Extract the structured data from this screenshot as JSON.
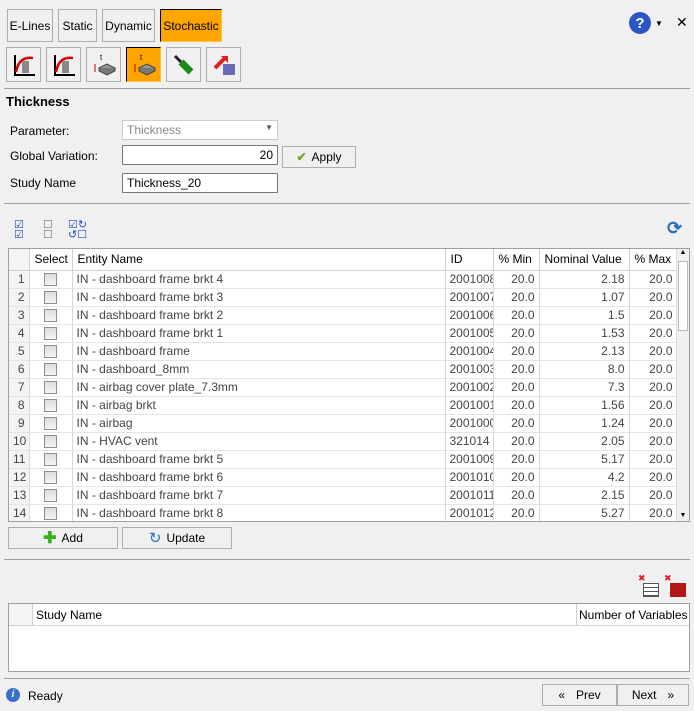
{
  "tabs": [
    {
      "label": "E-Lines",
      "active": false
    },
    {
      "label": "Static",
      "active": false
    },
    {
      "label": "Dynamic",
      "active": false
    },
    {
      "label": "Stochastic",
      "active": true
    }
  ],
  "toolbar_icons": [
    "tensile-test-icon",
    "tensile-test-curve-icon",
    "thickness-icon",
    "thickness-stochastic-icon",
    "screwdriver-icon",
    "export-mesh-icon"
  ],
  "help_icon": "help-icon",
  "accent": "#ffa500",
  "section_title": "Thickness",
  "form": {
    "parameter_label": "Parameter:",
    "parameter_value": "Thickness",
    "global_variation_label": "Global Variation:",
    "global_variation_value": "20",
    "apply_label": "Apply",
    "study_name_label": "Study Name",
    "study_name_value": "Thickness_20"
  },
  "table": {
    "columns": [
      "",
      "Select",
      "Entity Name",
      "ID",
      "% Min",
      "Nominal Value",
      "% Max"
    ],
    "rows": [
      [
        "1",
        "IN - dashboard frame brkt 4",
        "2001008",
        "20.0",
        "2.18",
        "20.0"
      ],
      [
        "2",
        "IN - dashboard frame brkt 3",
        "2001007",
        "20.0",
        "1.07",
        "20.0"
      ],
      [
        "3",
        "IN - dashboard frame brkt 2",
        "2001006",
        "20.0",
        "1.5",
        "20.0"
      ],
      [
        "4",
        "IN - dashboard frame brkt 1",
        "2001005",
        "20.0",
        "1.53",
        "20.0"
      ],
      [
        "5",
        "IN - dashboard frame",
        "2001004",
        "20.0",
        "2.13",
        "20.0"
      ],
      [
        "6",
        "IN - dashboard_8mm",
        "2001003",
        "20.0",
        "8.0",
        "20.0"
      ],
      [
        "7",
        "IN - airbag cover plate_7.3mm",
        "2001002",
        "20.0",
        "7.3",
        "20.0"
      ],
      [
        "8",
        "IN - airbag brkt",
        "2001001",
        "20.0",
        "1.56",
        "20.0"
      ],
      [
        "9",
        "IN - airbag",
        "2001000",
        "20.0",
        "1.24",
        "20.0"
      ],
      [
        "10",
        "IN - HVAC vent",
        "321014",
        "20.0",
        "2.05",
        "20.0"
      ],
      [
        "11",
        "IN - dashboard frame brkt 5",
        "2001009",
        "20.0",
        "5.17",
        "20.0"
      ],
      [
        "12",
        "IN - dashboard frame brkt 6",
        "2001010",
        "20.0",
        "4.2",
        "20.0"
      ],
      [
        "13",
        "IN - dashboard frame brkt 7",
        "2001011",
        "20.0",
        "2.15",
        "20.0"
      ],
      [
        "14",
        "IN - dashboard frame brkt 8",
        "2001012",
        "20.0",
        "5.27",
        "20.0"
      ]
    ]
  },
  "buttons": {
    "add": "Add",
    "update": "Update"
  },
  "studies": {
    "columns": [
      "",
      "Study Name",
      "Number of Variables"
    ],
    "rows": []
  },
  "status": {
    "text": "Ready"
  },
  "nav": {
    "prev": "Prev",
    "next": "Next"
  }
}
